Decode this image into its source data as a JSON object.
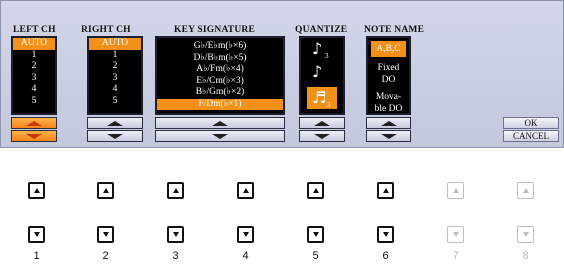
{
  "left_ch": {
    "header": "LEFT CH",
    "items": [
      "AUTO",
      "1",
      "2",
      "3",
      "4",
      "5"
    ],
    "selected": "AUTO"
  },
  "right_ch": {
    "header": "RIGHT CH",
    "items": [
      "AUTO",
      "1",
      "2",
      "3",
      "4",
      "5"
    ],
    "selected": "AUTO"
  },
  "key_signature": {
    "header": "KEY SIGNATURE",
    "items": [
      "G♭/E♭m(♭×6)",
      "D♭/B♭m(♭×5)",
      "A♭/Fm(♭×4)",
      "E♭/Cm(♭×3)",
      "B♭/Gm(♭×2)",
      "F/Dm(♭×1)"
    ],
    "selected": "F/Dm(♭×1)"
  },
  "quantize": {
    "header": "QUANTIZE",
    "items": [
      "♪3",
      "♪",
      "♬3"
    ],
    "sub": "3"
  },
  "note_name": {
    "header": "NOTE NAME",
    "items": [
      "A,B,C",
      "Fixed DO",
      "Mova- ble DO"
    ],
    "selected": "A,B,C",
    "fixed_line1": "Fixed",
    "fixed_line2": "DO",
    "movable_line1": "Mova-",
    "movable_line2": "ble DO"
  },
  "side_buttons": {
    "ok": "OK",
    "cancel": "CANCEL"
  },
  "panel_buttons": {
    "numbers": [
      "1",
      "2",
      "3",
      "4",
      "5",
      "6",
      "7",
      "8"
    ],
    "active_count": 6
  },
  "colors": {
    "accent": "#f39018",
    "panel_bg": "#c8cce0",
    "list_bg": "#000000"
  }
}
